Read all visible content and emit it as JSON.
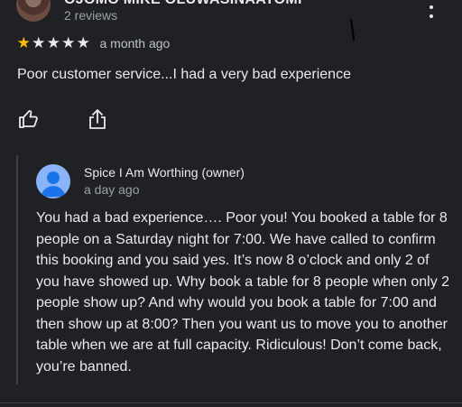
{
  "reviewer": {
    "name": "OJOMO MIKE OLUWASINAATOMI",
    "review_count": "2 reviews"
  },
  "review": {
    "rating": 1,
    "max_rating": 5,
    "date": "a month ago",
    "text": "Poor customer service...I had a very bad experience"
  },
  "actions": {
    "like_icon": "thumbs-up-icon",
    "share_icon": "share-icon",
    "menu_icon": "more-vert-icon"
  },
  "owner_reply": {
    "name": "Spice I Am Worthing (owner)",
    "date": "a day ago",
    "text": "You had a bad experience…. Poor you! You booked a table for 8 people on a Saturday night for 7:00. We have called to confirm this booking and you said yes. It’s now 8 o’clock and only 2 of you have showed up. Why book a table for 8 people when only 2 people show up? And why would you book a table for 7:00 and then show up at 8:00? Then you want us to move you to another table when we are at full capacity. Ridiculous! Don’t come back, you’re banned."
  },
  "colors": {
    "background": "#202124",
    "star_filled": "#fbbc04",
    "owner_avatar": "#8ab4f8"
  }
}
